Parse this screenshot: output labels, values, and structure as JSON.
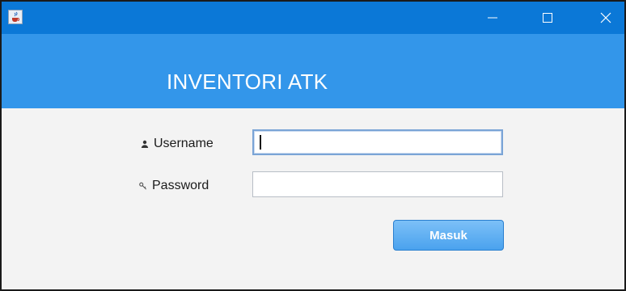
{
  "window": {
    "controls": {
      "minimize": "minimize-icon",
      "maximize": "maximize-icon",
      "close": "close-icon"
    },
    "icon": "java-cup-icon"
  },
  "banner": {
    "title": "INVENTORI ATK"
  },
  "form": {
    "username": {
      "label": "Username",
      "icon": "person-icon",
      "value": ""
    },
    "password": {
      "label": "Password",
      "icon": "key-icon",
      "value": ""
    },
    "submit_label": "Masuk"
  },
  "colors": {
    "titlebar": "#0b78d7",
    "banner": "#3396ea",
    "button": "#4aa2ee",
    "background": "#f3f3f3"
  }
}
